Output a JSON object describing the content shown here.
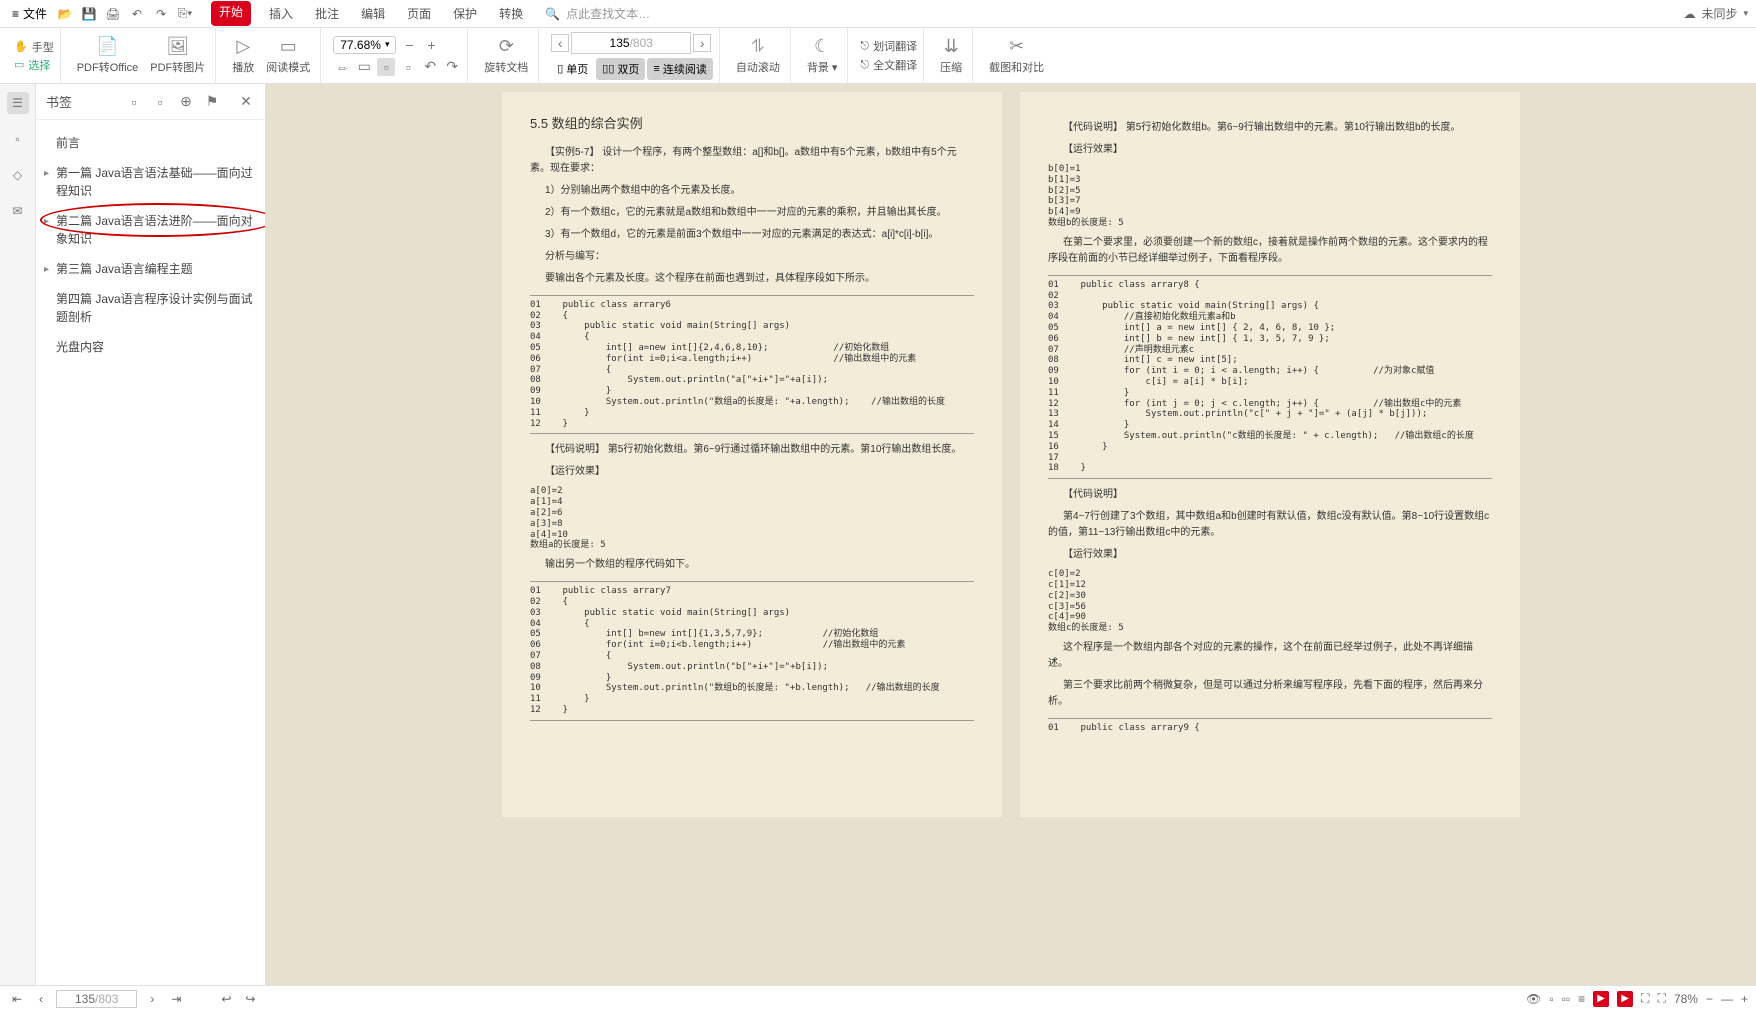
{
  "menubar": {
    "file_label": "文件",
    "tabs": [
      "开始",
      "插入",
      "批注",
      "编辑",
      "页面",
      "保护",
      "转换"
    ],
    "search_placeholder": "点此查找文本…",
    "sync_label": "未同步"
  },
  "toolbar": {
    "hand": "手型",
    "select": "选择",
    "pdf_office": "PDF转Office",
    "pdf_image": "PDF转图片",
    "play": "播放",
    "read_mode": "阅读模式",
    "zoom": "77.68%",
    "rotate": "旋转文档",
    "single_page": "单页",
    "double_page": "双页",
    "continuous": "连续阅读",
    "auto_scroll": "自动滚动",
    "background": "背景",
    "word_translate": "划词翻译",
    "full_translate": "全文翻译",
    "compress": "压缩",
    "crop_compare": "截图和对比",
    "page_current": "135",
    "page_total": "/803"
  },
  "bookmarks": {
    "title": "书签",
    "items": [
      {
        "label": "前言",
        "children": false
      },
      {
        "label": "第一篇 Java语言语法基础——面向过程知识",
        "children": true
      },
      {
        "label": "第二篇 Java语言语法进阶——面向对象知识",
        "children": true,
        "highlight": true
      },
      {
        "label": "第三篇 Java语言编程主题",
        "children": true
      },
      {
        "label": "第四篇 Java语言程序设计实例与面试题剖析",
        "children": false
      },
      {
        "label": "光盘内容",
        "children": false
      }
    ]
  },
  "page_left": {
    "heading": "5.5  数组的综合实例",
    "p1": "【实例5-7】 设计一个程序，有两个整型数组：a[]和b[]。a数组中有5个元素，b数组中有5个元素。现在要求：",
    "p2": "1）分别输出两个数组中的各个元素及长度。",
    "p3": "2）有一个数组c，它的元素就是a数组和b数组中一一对应的元素的乘积，并且输出其长度。",
    "p4": "3）有一个数组d，它的元素是前面3个数组中一一对应的元素满足的表达式：a[i]*c[i]-b[i]。",
    "p5": "分析与编写：",
    "p6": "要输出各个元素及长度。这个程序在前面也遇到过，具体程序段如下所示。",
    "code1": "01    public class arrary6\n02    {\n03        public static void main(String[] args)\n04        {\n05            int[] a=new int[]{2,4,6,8,10};            //初始化数组\n06            for(int i=0;i<a.length;i++)               //输出数组中的元素\n07            {\n08                System.out.println(\"a[\"+i+\"]=\"+a[i]);\n09            }\n10            System.out.println(\"数组a的长度是: \"+a.length);    //输出数组的长度\n11        }\n12    }",
    "p7": "【代码说明】 第5行初始化数组。第6~9行通过循环输出数组中的元素。第10行输出数组长度。",
    "p8": "【运行效果】",
    "out1": "a[0]=2\na[1]=4\na[2]=6\na[3]=8\na[4]=10\n数组a的长度是: 5",
    "p9": "输出另一个数组的程序代码如下。",
    "code2": "01    public class arrary7\n02    {\n03        public static void main(String[] args)\n04        {\n05            int[] b=new int[]{1,3,5,7,9};           //初始化数组\n06            for(int i=0;i<b.length;i++)             //输出数组中的元素\n07            {\n08                System.out.println(\"b[\"+i+\"]=\"+b[i]);\n09            }\n10            System.out.println(\"数组b的长度是: \"+b.length);   //输出数组的长度\n11        }\n12    }"
  },
  "page_right": {
    "p1": "【代码说明】 第5行初始化数组b。第6~9行输出数组中的元素。第10行输出数组b的长度。",
    "p2": "【运行效果】",
    "out1": "b[0]=1\nb[1]=3\nb[2]=5\nb[3]=7\nb[4]=9\n数组b的长度是: 5",
    "p3": "在第二个要求里，必须要创建一个新的数组c，接着就是操作前两个数组的元素。这个要求内的程序段在前面的小节已经详细举过例子，下面看程序段。",
    "code1": "01    public class arrary8 {\n02\n03        public static void main(String[] args) {\n04            //直接初始化数组元素a和b\n05            int[] a = new int[] { 2, 4, 6, 8, 10 };\n06            int[] b = new int[] { 1, 3, 5, 7, 9 };\n07            //声明数组元素c\n08            int[] c = new int[5];\n09            for (int i = 0; i < a.length; i++) {          //为对象c赋值\n10                c[i] = a[i] * b[i];\n11            }\n12            for (int j = 0; j < c.length; j++) {          //输出数组c中的元素\n13                System.out.println(\"c[\" + j + \"]=\" + (a[j] * b[j]));\n14            }\n15            System.out.println(\"c数组的长度是: \" + c.length);   //输出数组c的长度\n16        }\n17\n18    }",
    "p4": "【代码说明】",
    "p5": "第4~7行创建了3个数组，其中数组a和b创建时有默认值，数组c没有默认值。第8~10行设置数组c的值，第11~13行输出数组c中的元素。",
    "p6": "【运行效果】",
    "out2": "c[0]=2\nc[1]=12\nc[2]=30\nc[3]=56\nc[4]=90\n数组c的长度是: 5",
    "p7": "这个程序是一个数组内部各个对应的元素的操作，这个在前面已经举过例子，此处不再详细描述。",
    "p8": "第三个要求比前两个稍微复杂，但是可以通过分析来编写程序段，先看下面的程序，然后再来分析。",
    "code2": "01    public class arrary9 {"
  },
  "statusbar": {
    "page_current": "135",
    "page_total": "/803",
    "zoom": "78%"
  }
}
